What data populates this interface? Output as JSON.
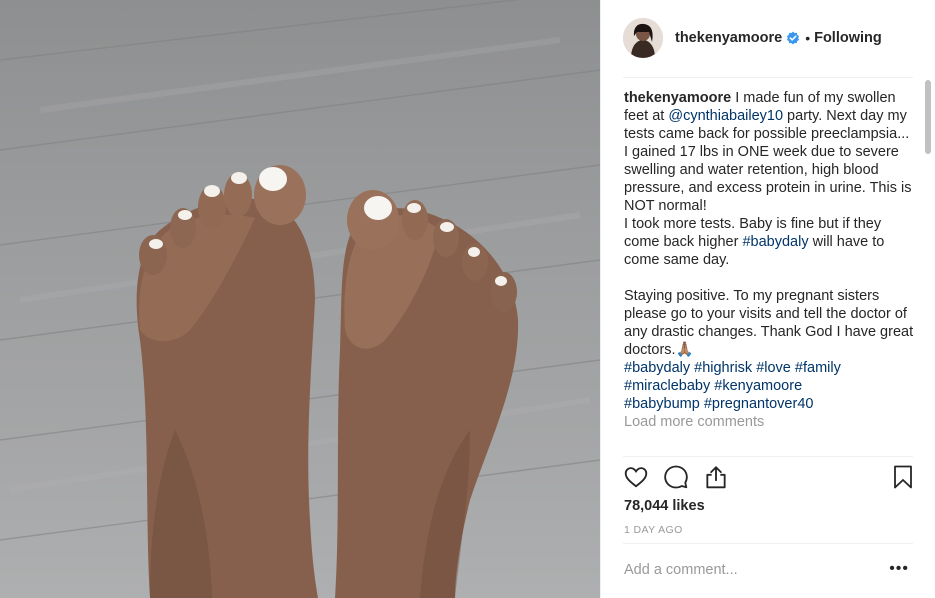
{
  "post": {
    "username": "thekenyamoore",
    "follow_sep": "•",
    "follow_label": "Following",
    "caption": {
      "username": "thekenyamoore",
      "t1": " I made fun of my swollen feet at ",
      "mention": "@cynthiabailey10",
      "t2": " party. Next day my tests came back for possible preeclampsia... I gained 17 lbs in ONE week due to severe swelling and water retention, high blood pressure, and excess protein in urine. This is NOT normal!\nI took more tests. Baby is fine but if they come back higher ",
      "tag_babydaly_inline": "#babydaly",
      "t3": " will have to come same day.\n\nStaying positive. To my pregnant sisters please go to your visits and tell the doctor of any drastic changes. Thank God I have great doctors.🙏🏽\n",
      "tags": [
        "#babydaly",
        "#highrisk",
        "#love",
        "#family",
        "#miraclebaby",
        "#kenyamoore",
        "#babybump",
        "#pregnantover40"
      ],
      "load_more": "Load more comments"
    },
    "likes": "78,044 likes",
    "time": "1 DAY AGO",
    "comment_placeholder": "Add a comment...",
    "more_options": "•••"
  },
  "icons": {
    "verified": "verified-badge-icon",
    "like": "heart-icon",
    "comment": "comment-bubble-icon",
    "share": "share-icon",
    "save": "bookmark-icon"
  },
  "colors": {
    "link": "#003569",
    "verified": "#3897f0",
    "muted": "#999999"
  }
}
